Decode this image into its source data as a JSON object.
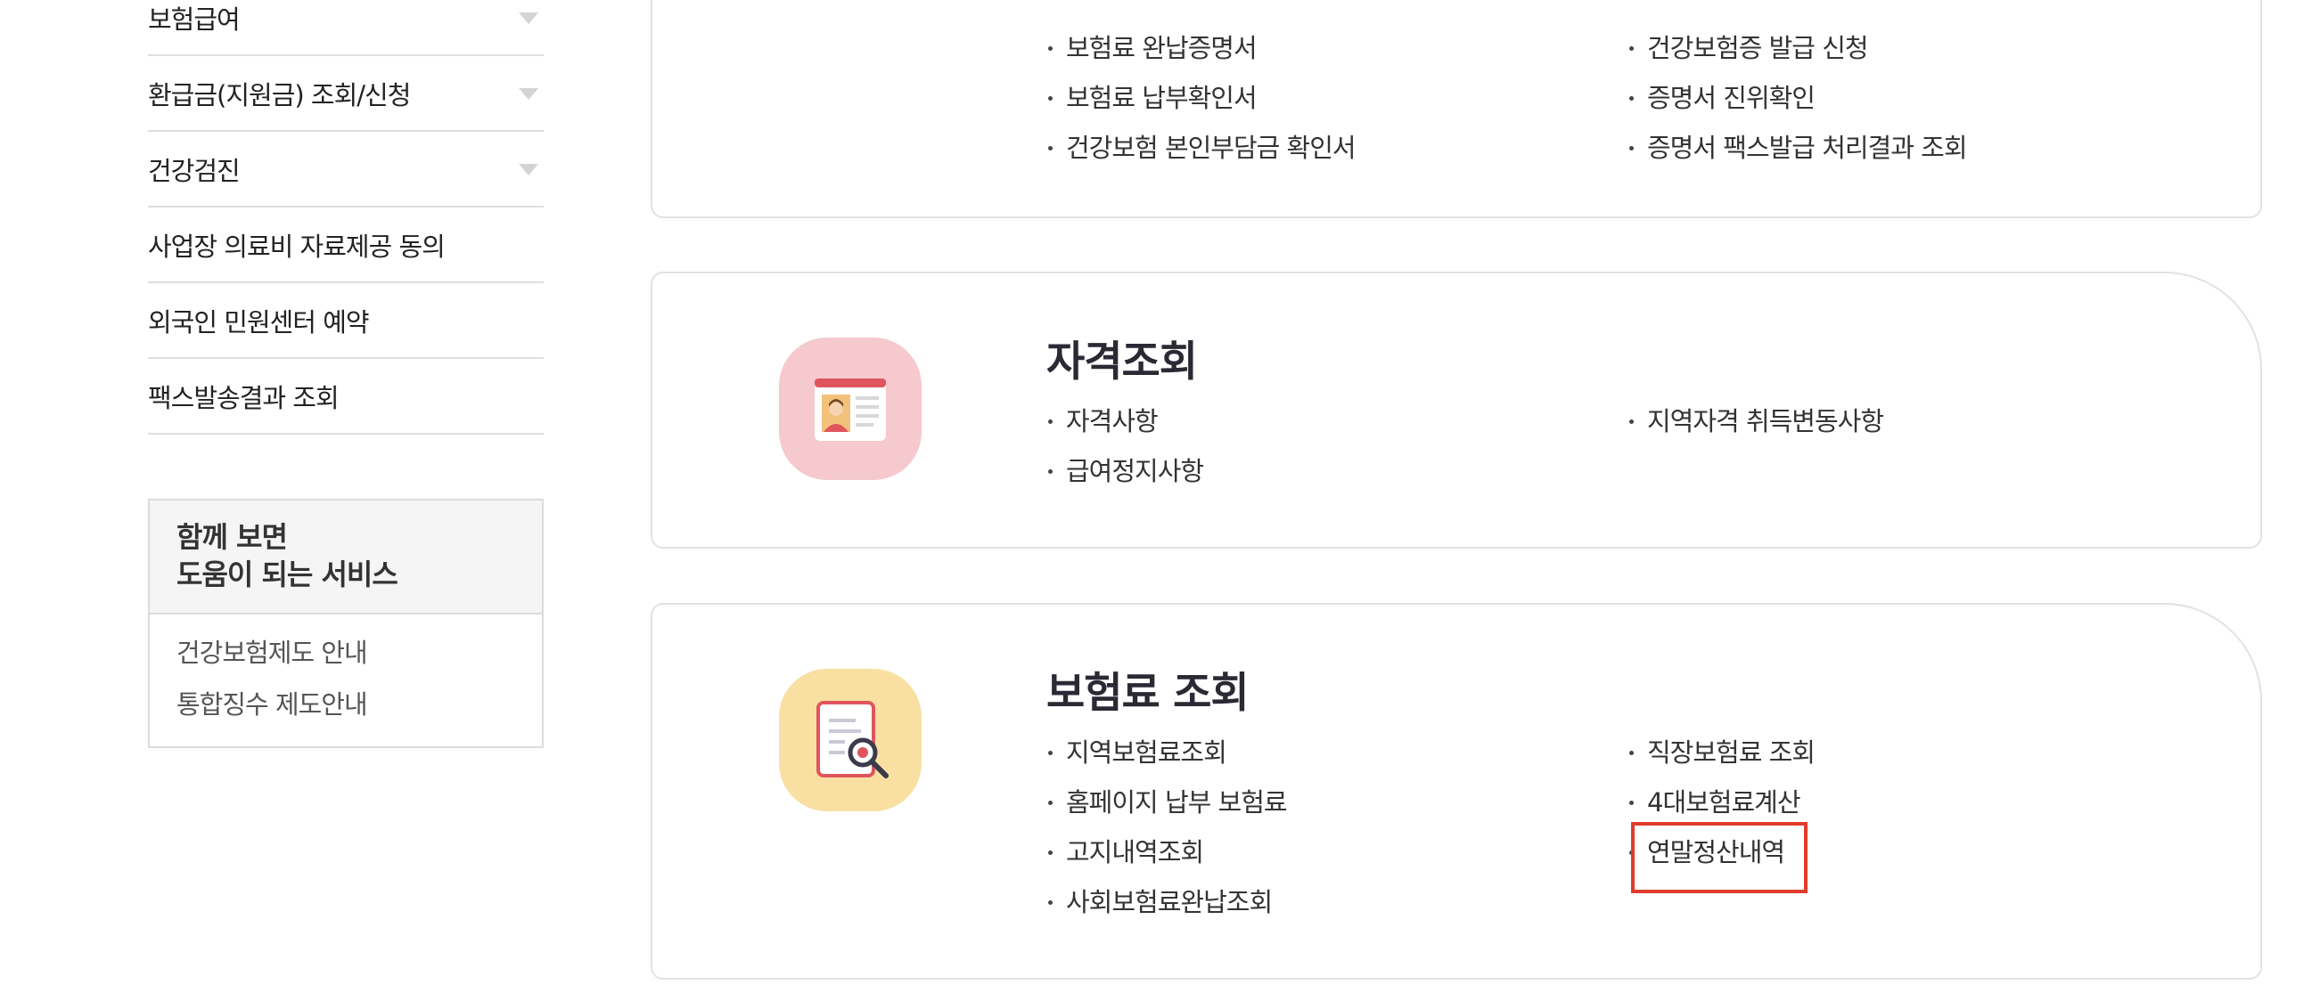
{
  "sidebar": {
    "menu": [
      {
        "label": "보험급여",
        "has_arrow": true
      },
      {
        "label": "환급금(지원금) 조회/신청",
        "has_arrow": true
      },
      {
        "label": "건강검진",
        "has_arrow": true
      },
      {
        "label": "사업장 의료비 자료제공 동의",
        "has_arrow": false
      },
      {
        "label": "외국인 민원센터 예약",
        "has_arrow": false
      },
      {
        "label": "팩스발송결과 조회",
        "has_arrow": false
      }
    ],
    "related": {
      "title_line1": "함께 보면",
      "title_line2": "도움이 되는 서비스",
      "links": [
        "건강보험제도 안내",
        "통합징수 제도안내"
      ]
    }
  },
  "cards": {
    "certificates": {
      "left_links": [
        "보험료 완납증명서",
        "보험료 납부확인서",
        "건강보험 본인부담금 확인서"
      ],
      "right_links": [
        "건강보험증 발급 신청",
        "증명서 진위확인",
        "증명서 팩스발급 처리결과 조회"
      ]
    },
    "qualification": {
      "title": "자격조회",
      "icon": "id-card-icon",
      "left_links": [
        "자격사항",
        "급여정지사항"
      ],
      "right_links": [
        "지역자격 취득변동사항"
      ]
    },
    "premium": {
      "title": "보험료 조회",
      "icon": "document-magnifier-icon",
      "left_links": [
        "지역보험료조회",
        "홈페이지 납부 보험료",
        "고지내역조회",
        "사회보험료완납조회"
      ],
      "right_links": [
        "직장보험료 조회",
        "4대보험료계산",
        "연말정산내역"
      ]
    }
  },
  "colors": {
    "highlight": "#e03c2c",
    "qual_icon_bg": "#f5c9cd",
    "prem_icon_bg": "#f9e0a2"
  }
}
